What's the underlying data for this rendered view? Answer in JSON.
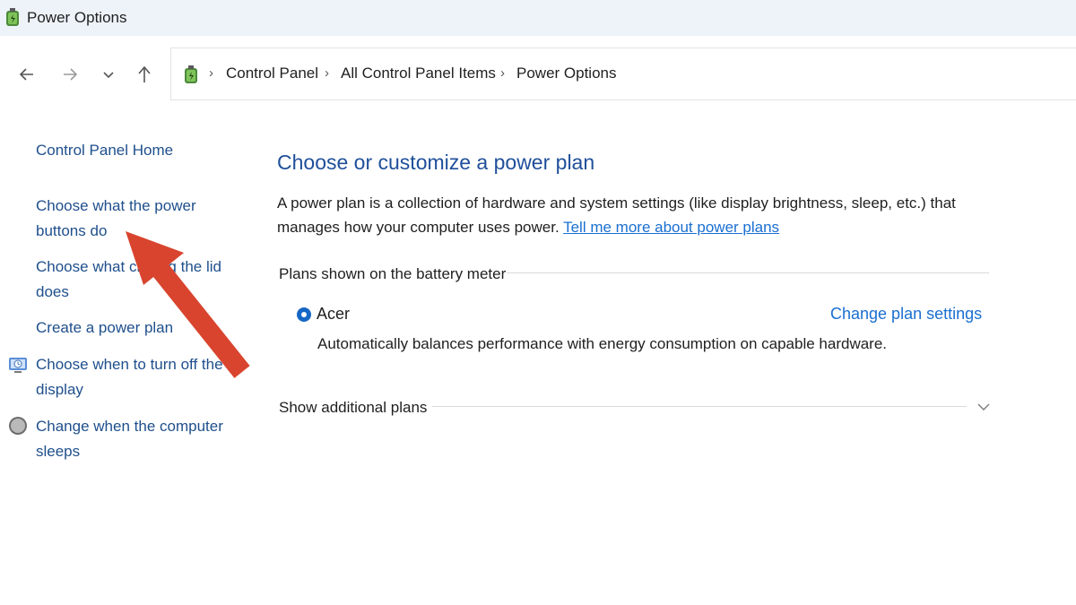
{
  "window": {
    "title": "Power Options"
  },
  "navigation": {
    "back_icon": "arrow-left-icon",
    "forward_icon": "arrow-right-icon",
    "recent_icon": "chevron-down-icon",
    "up_icon": "arrow-up-icon"
  },
  "breadcrumb": {
    "icon": "control-panel-icon",
    "items": [
      "Control Panel",
      "All Control Panel Items",
      "Power Options"
    ]
  },
  "sidebar": {
    "home": "Control Panel Home",
    "links": [
      {
        "label": "Choose what the power buttons do",
        "icon": null
      },
      {
        "label": "Choose what closing the lid does",
        "icon": null
      },
      {
        "label": "Create a power plan",
        "icon": null
      },
      {
        "label": "Choose when to turn off the display",
        "icon": "display-icon"
      },
      {
        "label": "Change when the computer sleeps",
        "icon": "sleep-moon-icon"
      }
    ]
  },
  "main": {
    "heading": "Choose or customize a power plan",
    "description": "A power plan is a collection of hardware and system settings (like display brightness, sleep, etc.) that manages how your computer uses power.",
    "learn_more_link": "Tell me more about power plans",
    "battery_meter_group": "Plans shown on the battery meter",
    "plan": {
      "name": "Acer",
      "selected": true,
      "change_link": "Change plan settings",
      "description": "Automatically balances performance with energy consumption on capable hardware."
    },
    "additional_plans": "Show additional plans"
  },
  "annotation": {
    "arrow_color": "#d9442e"
  },
  "colors": {
    "link": "#1f4f8c",
    "accent": "#1666c5",
    "heading": "#1f4f9a"
  }
}
